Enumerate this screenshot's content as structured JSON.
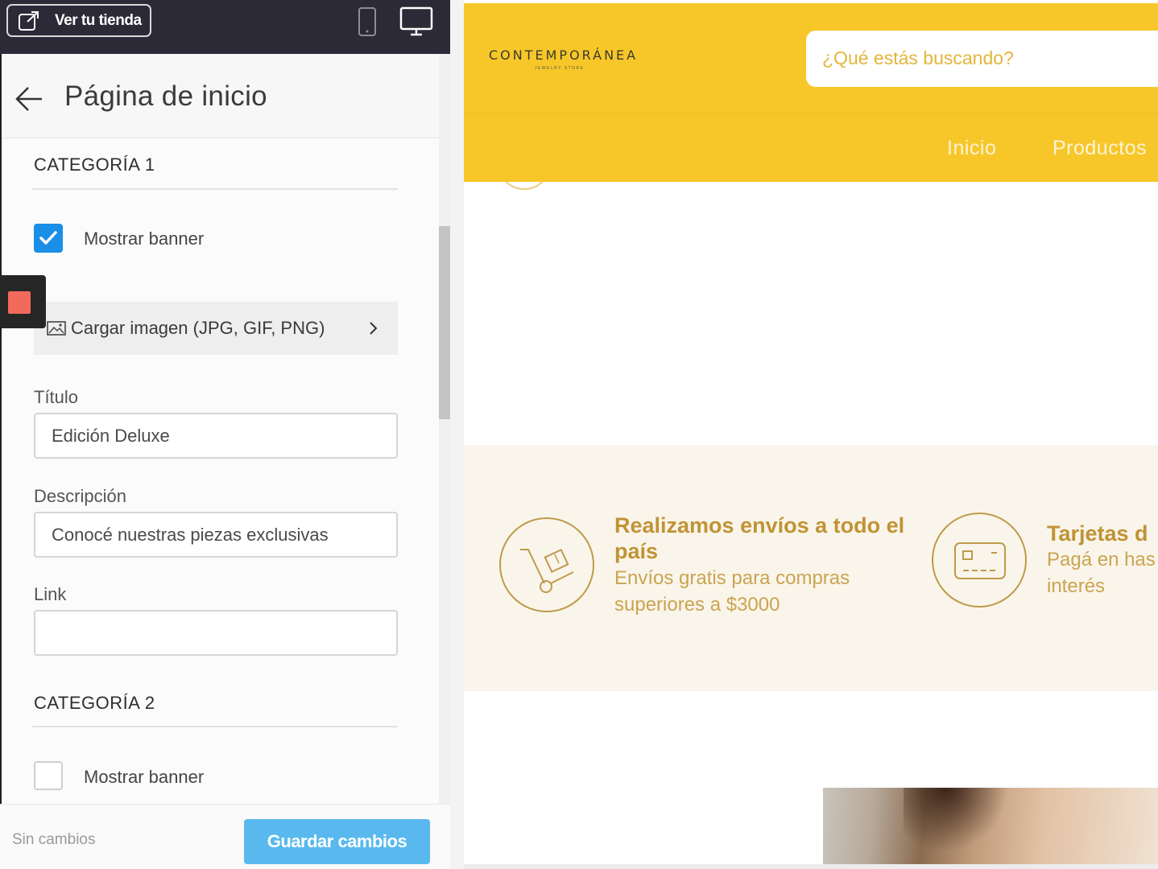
{
  "topbar": {
    "view_store_label": "Ver tu tienda"
  },
  "panel": {
    "title": "Página de inicio",
    "category1": {
      "title": "CATEGORÍA 1",
      "show_banner_label": "Mostrar banner",
      "show_banner_checked": true,
      "upload_label": "Cargar imagen (JPG, GIF, PNG)",
      "title_label": "Título",
      "title_value": "Edición Deluxe",
      "description_label": "Descripción",
      "description_value": "Conocé nuestras piezas exclusivas",
      "link_label": "Link",
      "link_value": ""
    },
    "category2": {
      "title": "CATEGORÍA 2",
      "show_banner_label": "Mostrar banner",
      "show_banner_checked": false
    }
  },
  "footer": {
    "status": "Sin cambios",
    "save_label": "Guardar cambios"
  },
  "preview": {
    "logo": "CONTEMPORÁNEA",
    "logo_sub": "JEWELRY STORE",
    "search_placeholder": "¿Qué estás buscando?",
    "nav": [
      "Inicio",
      "Productos"
    ],
    "feature1": {
      "title": "Realizamos envíos a todo el país",
      "text": "Envíos gratis para compras superiores a $3000"
    },
    "feature2": {
      "title": "Tarjetas d",
      "text": "Pagá en has interés"
    }
  },
  "colors": {
    "store_yellow": "#f7c72a",
    "save_blue": "#59b9ee",
    "checkbox_blue": "#1b8ee6",
    "gold_text": "#c09335"
  }
}
